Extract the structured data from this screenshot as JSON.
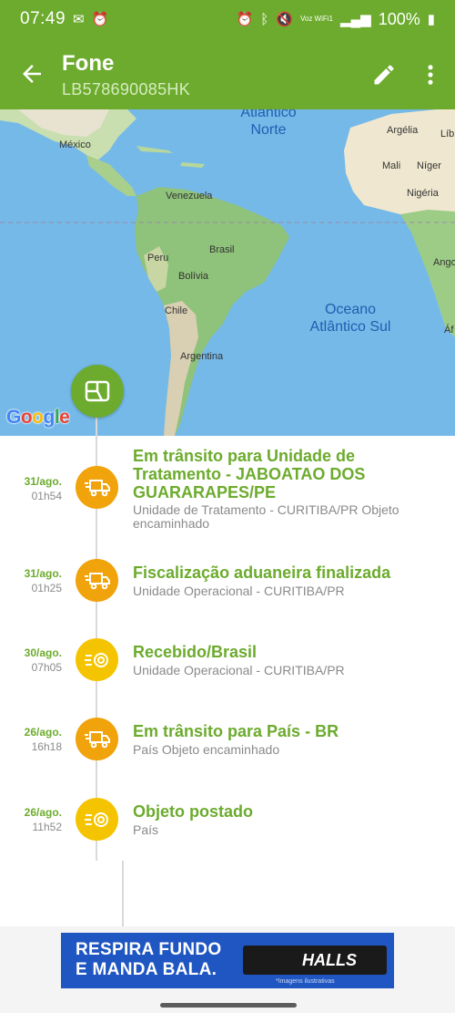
{
  "status_bar": {
    "time": "07:49",
    "battery": "100%",
    "network_label": "Voz WiFi1"
  },
  "header": {
    "title": "Fone",
    "tracking_code": "LB578690085HK"
  },
  "map": {
    "country_labels": [
      "México",
      "Venezuela",
      "Brasil",
      "Peru",
      "Bolívia",
      "Chile",
      "Argentina",
      "Argélia",
      "Líb",
      "Mali",
      "Níger",
      "Nigéria",
      "Ango",
      "Áf"
    ],
    "ocean_north": [
      "Atlântico",
      "Norte"
    ],
    "ocean_south": [
      "Oceano",
      "Atlântico Sul"
    ],
    "provider": "Google"
  },
  "events": [
    {
      "date": "31/ago.",
      "time": "01h54",
      "icon": "truck-icon",
      "icon_color": "#f0a30a",
      "title": "Em trânsito para Unidade de Tratamento - JABOATAO DOS GUARARAPES/PE",
      "description": "Unidade de Tratamento - CURITIBA/PR Objeto encaminhado"
    },
    {
      "date": "31/ago.",
      "time": "01h25",
      "icon": "truck-icon",
      "icon_color": "#f0a30a",
      "title": "Fiscalização aduaneira finalizada",
      "description": "Unidade Operacional - CURITIBA/PR"
    },
    {
      "date": "30/ago.",
      "time": "07h05",
      "icon": "received-icon",
      "icon_color": "#f5c400",
      "title": "Recebido/Brasil",
      "description": "Unidade Operacional - CURITIBA/PR"
    },
    {
      "date": "26/ago.",
      "time": "16h18",
      "icon": "truck-icon",
      "icon_color": "#f0a30a",
      "title": "Em trânsito para País - BR",
      "description": "País Objeto encaminhado"
    },
    {
      "date": "26/ago.",
      "time": "11h52",
      "icon": "posted-icon",
      "icon_color": "#f5c400",
      "title": "Objeto postado",
      "description": "País"
    }
  ],
  "ad": {
    "line1": "RESPIRA FUNDO",
    "line2": "E MANDA BALA.",
    "brand": "HALLS",
    "note": "*Imagens ilustrativas"
  },
  "colors": {
    "brand_green": "#6cab2d",
    "truck_orange": "#f0a30a",
    "received_yellow": "#f5c400",
    "ocean": "#75b9e8"
  }
}
